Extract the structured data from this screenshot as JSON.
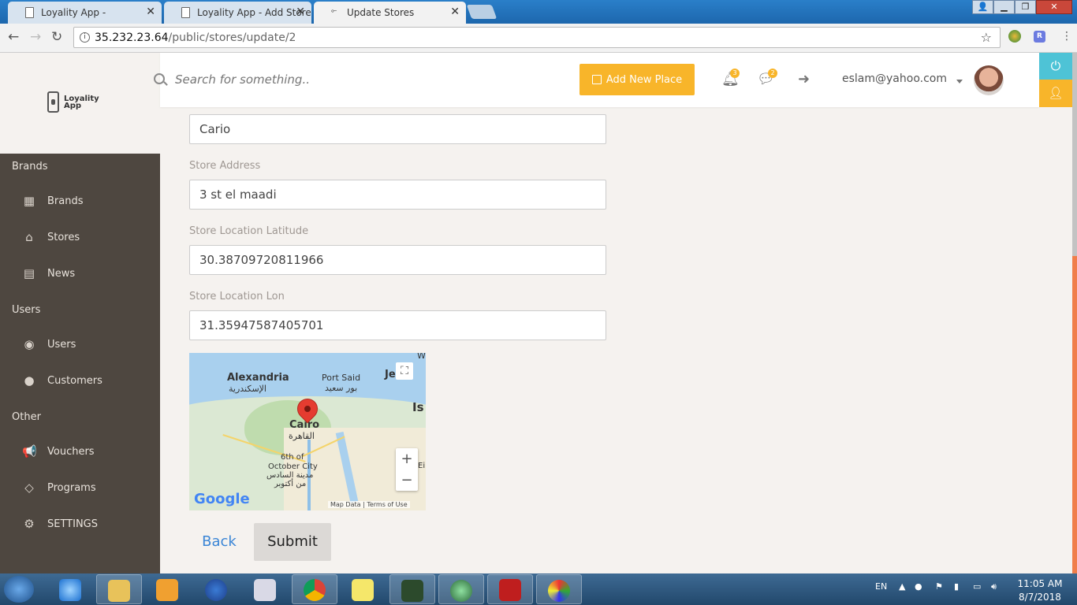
{
  "browser": {
    "tabs": [
      {
        "label": "Loyality App -"
      },
      {
        "label": "Loyality App - Add Stores"
      },
      {
        "label": "Update Stores"
      }
    ],
    "url_host": "35.232.23.64",
    "url_path": "/public/stores/update/2",
    "window_buttons": {
      "minimize": "▁",
      "maximize": "❐",
      "close": "✕"
    }
  },
  "app": {
    "logo_line1": "Loyality",
    "logo_line2": "App"
  },
  "sidebar": {
    "sections": [
      {
        "title": "Brands",
        "items": [
          {
            "label": "Brands",
            "icon": "grid-icon"
          },
          {
            "label": "Stores",
            "icon": "home-icon"
          },
          {
            "label": "News",
            "icon": "newspaper-icon"
          }
        ]
      },
      {
        "title": "Users",
        "items": [
          {
            "label": "Users",
            "icon": "user-circle-icon"
          },
          {
            "label": "Customers",
            "icon": "user-icon"
          }
        ]
      },
      {
        "title": "Other",
        "items": [
          {
            "label": "Vouchers",
            "icon": "megaphone-icon"
          },
          {
            "label": "Programs",
            "icon": "diamond-icon"
          },
          {
            "label": "SETTINGS",
            "icon": "gear-icon"
          }
        ]
      }
    ]
  },
  "header": {
    "search_placeholder": "Search for something..",
    "add_button_label": "Add New Place",
    "notifications_count": "3",
    "messages_count": "2",
    "user_email": "eslam@yahoo.com"
  },
  "form": {
    "city_value": "Cario",
    "address_label": "Store Address",
    "address_value": "3 st el maadi",
    "latitude_label": "Store Location Latitude",
    "latitude_value": "30.38709720811966",
    "longitude_label": "Store Location Lon",
    "longitude_value": "31.35947587405701",
    "back_label": "Back",
    "submit_label": "Submit"
  },
  "map": {
    "labels": {
      "alexandria": "Alexandria",
      "alexandria_ar": "الإسكندرية",
      "port_said": "Port Said",
      "port_said_ar": "بور سعيد",
      "jerusalem": "Je",
      "cairo": "Cairo",
      "cairo_ar": "القاهرة",
      "october": "6th of",
      "october2": "October City",
      "october_ar": "مدينة السادس",
      "october_ar2": "من أكتوبر",
      "is": "Is",
      "eil": "Eil",
      "w": "W"
    },
    "google": "Google",
    "map_data": "Map Data",
    "terms": "Terms of Use"
  },
  "taskbar": {
    "lang": "EN",
    "time": "11:05 AM",
    "date": "8/7/2018"
  }
}
